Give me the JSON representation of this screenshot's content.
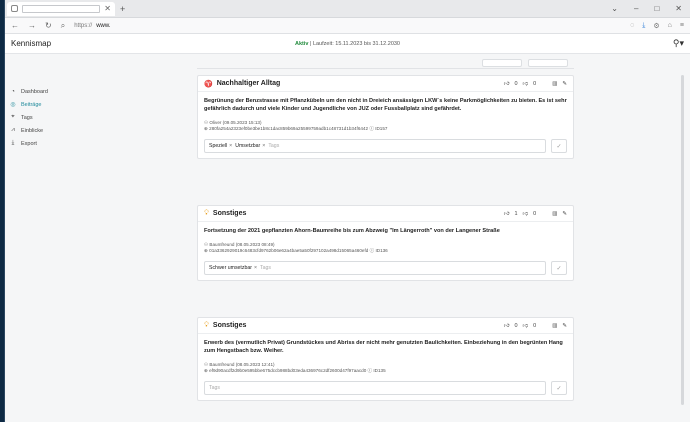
{
  "browser": {
    "url_prefix": "https://",
    "url_host": "www.",
    "icons": [
      "back-icon",
      "forward-icon",
      "reload-icon",
      "search-icon"
    ]
  },
  "header": {
    "brand": "Kennismap",
    "status_active": "Aktiv",
    "status_runtime": "| Laufzeit: 15.11.2023 bis 31.12.2030"
  },
  "sidebar": {
    "items": [
      {
        "label": "Dashboard",
        "icon": "dashboard-icon"
      },
      {
        "label": "Beiträge",
        "icon": "posts-icon"
      },
      {
        "label": "Tags",
        "icon": "tag-icon"
      },
      {
        "label": "Einblicke",
        "icon": "insights-icon"
      },
      {
        "label": "Export",
        "icon": "export-icon"
      }
    ]
  },
  "cards": [
    {
      "category": "Nachhaltiger Alltag",
      "likes": "0",
      "dislikes": "0",
      "text": "Begrünung der Benzstrasse mit Pflanzkübeln um den nicht in Dreieich ansässigen LKW´s keine Parkmöglichkeiten zu bieten. Es ist sehr gefährlich dadurch und viele Kinder und Jugendliche von JUZ oder Fussballplatz sind gefährdet.",
      "author": "Oliver (09.05.2023 15:13)",
      "hash": "280fa254a2323ef0be3be1b8c1dac859b69a25599759adb1c48731d1b34f6442",
      "id": "ID157",
      "tags": [
        "Speziell",
        "Umsetzbar"
      ],
      "tag_placeholder": "Tags"
    },
    {
      "category": "Sonstiges",
      "likes": "1",
      "dislikes": "0",
      "text": "Fortsetzung der 2021 gepflanzten Ahorn-Baumreihe bis zum Abzweig \"Im Längerroth\" von der Langener Straße",
      "author": "Baumfreund (08.05.2023 08:49)",
      "hash": "01a3362929019c6483cfd9762b06e62a4bae5a50f297102a498d15065a460efd",
      "id": "ID136",
      "tags": [
        "Schwer umsetzbar"
      ],
      "tag_placeholder": "Tags"
    },
    {
      "category": "Sonstiges",
      "likes": "0",
      "dislikes": "0",
      "text": "Erwerb des (vermutlich Privat) Grundstückes und Abriss der nicht mehr genutzten Baulichkeiten. Einbeziehung in den begrünten Hang zum Hengstbach bzw. Weiher.",
      "author": "Baumfreund (08.05.2023 12:41)",
      "hash": "ef9d90acdf2d9b0e595bbe675dccb988bd03eda436976c2df2600d47f97aacd0",
      "id": "ID135",
      "tags": [],
      "tag_placeholder": "Tags"
    }
  ]
}
